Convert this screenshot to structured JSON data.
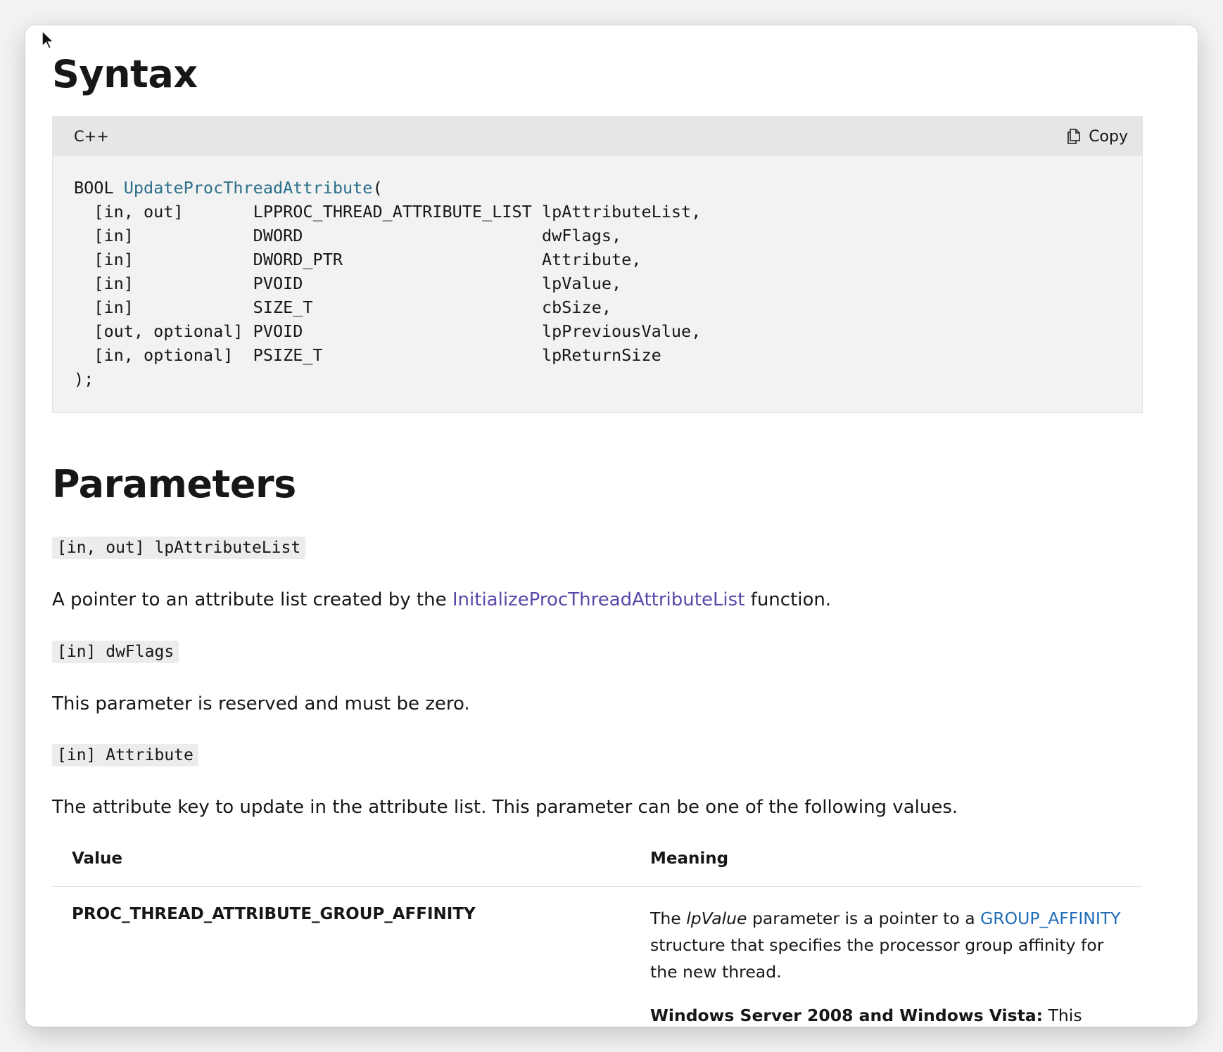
{
  "syntax": {
    "heading": "Syntax",
    "language": "C++",
    "copy_label": "Copy",
    "code_return_type": "BOOL ",
    "code_function": "UpdateProcThreadAttribute",
    "code_open": "(",
    "code_body": "\n  [in, out]       LPPROC_THREAD_ATTRIBUTE_LIST lpAttributeList,\n  [in]            DWORD                        dwFlags,\n  [in]            DWORD_PTR                    Attribute,\n  [in]            PVOID                        lpValue,\n  [in]            SIZE_T                       cbSize,\n  [out, optional] PVOID                        lpPreviousValue,\n  [in, optional]  PSIZE_T                      lpReturnSize\n);"
  },
  "parameters": {
    "heading": "Parameters",
    "items": [
      {
        "code": "[in, out] lpAttributeList",
        "desc_before": "A pointer to an attribute list created by the ",
        "desc_link": "InitializeProcThreadAttributeList",
        "desc_after": " function."
      },
      {
        "code": "[in] dwFlags",
        "desc": "This parameter is reserved and must be zero."
      },
      {
        "code": "[in] Attribute",
        "desc": "The attribute key to update in the attribute list. This parameter can be one of the following values."
      }
    ]
  },
  "table": {
    "col_value": "Value",
    "col_meaning": "Meaning",
    "rows": [
      {
        "value": "PROC_THREAD_ATTRIBUTE_GROUP_AFFINITY",
        "meaning_the": "The ",
        "meaning_italic": "lpValue",
        "meaning_mid": " parameter is a pointer to a ",
        "meaning_link": "GROUP_AFFINITY",
        "meaning_after": " structure that specifies the processor group affinity for the new thread.",
        "note_bold": "Windows Server 2008 and Windows Vista:",
        "note_text": "  This value is"
      }
    ]
  }
}
